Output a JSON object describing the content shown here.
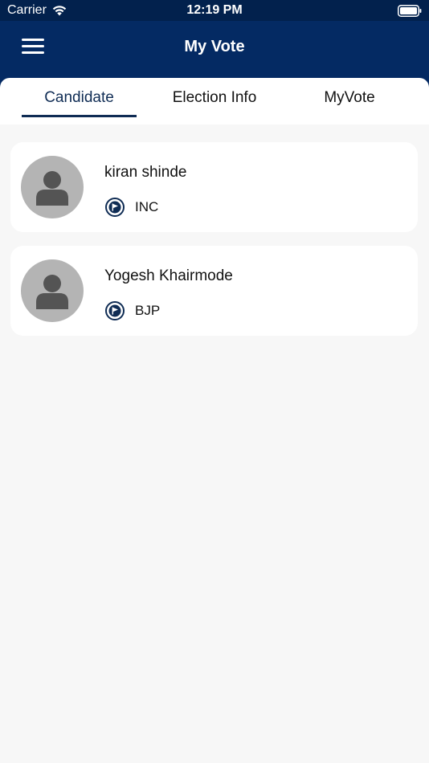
{
  "status_bar": {
    "carrier": "Carrier",
    "time": "12:19 PM",
    "wifi_icon": "wifi-icon",
    "battery_icon": "battery-icon"
  },
  "nav": {
    "title": "My Vote",
    "menu_icon": "hamburger-menu-icon"
  },
  "tabs": [
    {
      "label": "Candidate",
      "selected": true
    },
    {
      "label": "Election Info",
      "selected": false
    },
    {
      "label": "MyVote",
      "selected": false
    }
  ],
  "candidates": [
    {
      "name": "kiran shinde",
      "party": "INC",
      "party_icon": "flag-icon",
      "avatar_icon": "person-icon"
    },
    {
      "name": "Yogesh Khairmode",
      "party": "BJP",
      "party_icon": "flag-icon",
      "avatar_icon": "person-icon"
    }
  ],
  "colors": {
    "header_bg": "#042a63",
    "status_bar_bg": "#02214d",
    "accent": "#0f2c54",
    "background": "#f7f7f7",
    "avatar_bg": "#b4b4b4"
  }
}
